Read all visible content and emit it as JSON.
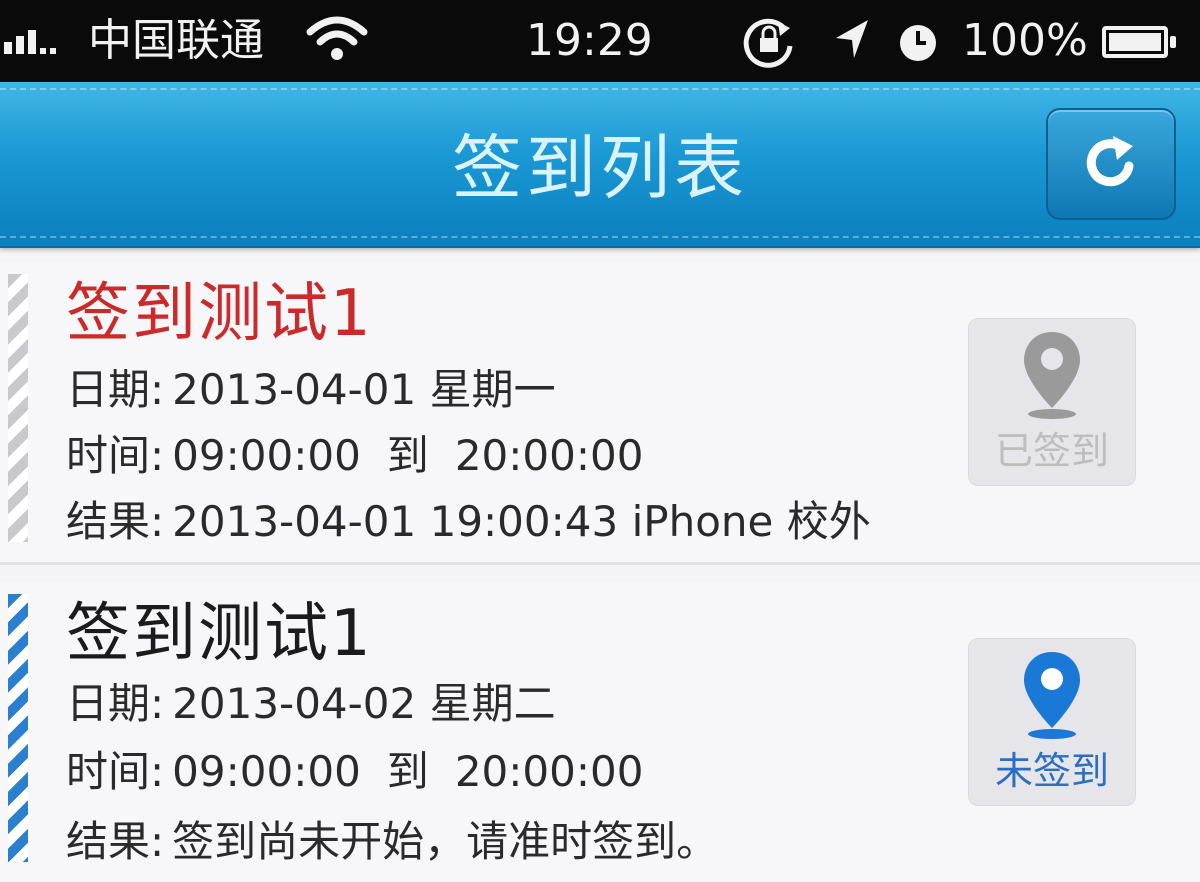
{
  "status_bar": {
    "carrier": "中国联通",
    "time": "19:29",
    "battery": "100%",
    "icons": [
      "signal-icon",
      "wifi-icon",
      "rotation-lock-icon",
      "location-arrow-icon",
      "alarm-icon",
      "battery-icon"
    ]
  },
  "nav": {
    "title": "签到列表",
    "refresh_icon": "refresh-icon"
  },
  "colors": {
    "nav_blue": "#1a98d4",
    "title_red": "#cc2a2a",
    "pin_blue": "#1a78d6",
    "pin_gray": "#9a9a9a"
  },
  "items": [
    {
      "title": "签到测试1",
      "date_label": "日期:",
      "date_value": "2013-04-01 星期一",
      "time_label": "时间:",
      "time_start": "09:00:00",
      "time_to": "到",
      "time_end": "20:00:00",
      "result_label": "结果:",
      "result_value": "2013-04-01 19:00:43 iPhone 校外",
      "status": "已签到",
      "status_icon": "map-pin-icon"
    },
    {
      "title": "签到测试1",
      "date_label": "日期:",
      "date_value": "2013-04-02 星期二",
      "time_label": "时间:",
      "time_start": "09:00:00",
      "time_to": "到",
      "time_end": "20:00:00",
      "result_label": "结果:",
      "result_value": "签到尚未开始，请准时签到。",
      "status": "未签到",
      "status_icon": "map-pin-icon"
    }
  ]
}
